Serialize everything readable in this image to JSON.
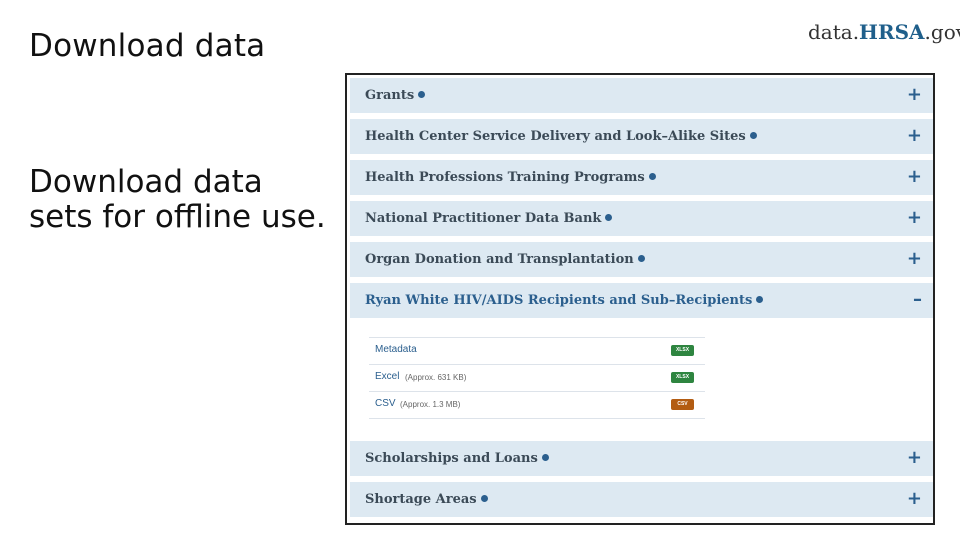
{
  "slide": {
    "title": "Download data",
    "body": "Download data sets for offline use."
  },
  "logo": {
    "prefix": "data.",
    "brand": "HRSA",
    "suffix": ".gov"
  },
  "accordion": {
    "items": [
      {
        "label": "Grants",
        "toggle": "+"
      },
      {
        "label": "Health Center Service Delivery and Look–Alike Sites",
        "toggle": "+"
      },
      {
        "label": "Health Professions Training Programs",
        "toggle": "+"
      },
      {
        "label": "National Practitioner Data Bank",
        "toggle": "+"
      },
      {
        "label": "Organ Donation and Transplantation",
        "toggle": "+"
      },
      {
        "label": "Ryan White HIV/AIDS Recipients and Sub–Recipients",
        "toggle": "–"
      },
      {
        "label": "Scholarships and Loans",
        "toggle": "+"
      },
      {
        "label": "Shortage Areas",
        "toggle": "+"
      }
    ]
  },
  "files": [
    {
      "name": "Metadata",
      "size": "",
      "format": "XLSX",
      "format_color": "#2e8540"
    },
    {
      "name": "Excel",
      "size": "(Approx. 631 KB)",
      "format": "XLSX",
      "format_color": "#2e8540"
    },
    {
      "name": "CSV",
      "size": "(Approx. 1.3 MB)",
      "format": "CSV",
      "format_color": "#b35c12"
    }
  ],
  "colors": {
    "accordion_bg": "#dde9f2",
    "link": "#2b5f8e"
  }
}
